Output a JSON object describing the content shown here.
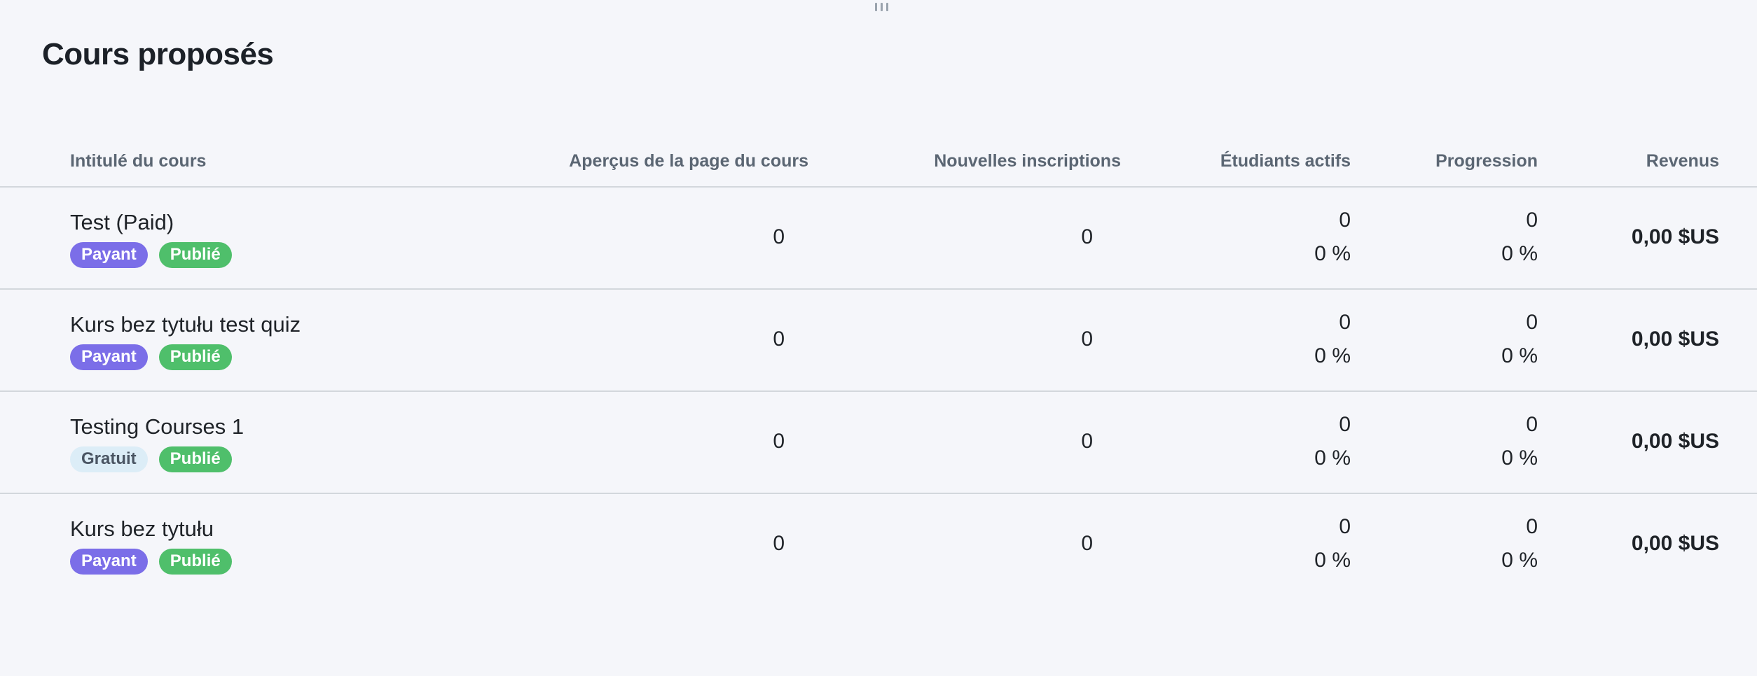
{
  "page": {
    "title": "Cours proposés"
  },
  "table": {
    "headers": {
      "title": "Intitulé du cours",
      "views": "Aperçus de la page du cours",
      "enrollments": "Nouvelles inscriptions",
      "active": "Étudiants actifs",
      "progress": "Progression",
      "revenue": "Revenus"
    },
    "rows": [
      {
        "title": "Test (Paid)",
        "price_badge": "Payant",
        "price_type": "paid",
        "status_badge": "Publié",
        "views": "0",
        "enrollments": "0",
        "active_count": "0",
        "active_pct": "0 %",
        "progress_count": "0",
        "progress_pct": "0 %",
        "revenue": "0,00 $US"
      },
      {
        "title": "Kurs bez tytułu test quiz",
        "price_badge": "Payant",
        "price_type": "paid",
        "status_badge": "Publié",
        "views": "0",
        "enrollments": "0",
        "active_count": "0",
        "active_pct": "0 %",
        "progress_count": "0",
        "progress_pct": "0 %",
        "revenue": "0,00 $US"
      },
      {
        "title": "Testing Courses 1",
        "price_badge": "Gratuit",
        "price_type": "free",
        "status_badge": "Publié",
        "views": "0",
        "enrollments": "0",
        "active_count": "0",
        "active_pct": "0 %",
        "progress_count": "0",
        "progress_pct": "0 %",
        "revenue": "0,00 $US"
      },
      {
        "title": "Kurs bez tytułu",
        "price_badge": "Payant",
        "price_type": "paid",
        "status_badge": "Publié",
        "views": "0",
        "enrollments": "0",
        "active_count": "0",
        "active_pct": "0 %",
        "progress_count": "0",
        "progress_pct": "0 %",
        "revenue": "0,00 $US"
      }
    ]
  },
  "colors": {
    "background": "#f5f6fa",
    "paid_badge": "#7b6ee8",
    "free_badge": "#dcedf7",
    "published_badge": "#4fbf6b",
    "divider": "#d3d7dc"
  },
  "icons": {
    "drag_handle": "drag-handle-icon"
  }
}
